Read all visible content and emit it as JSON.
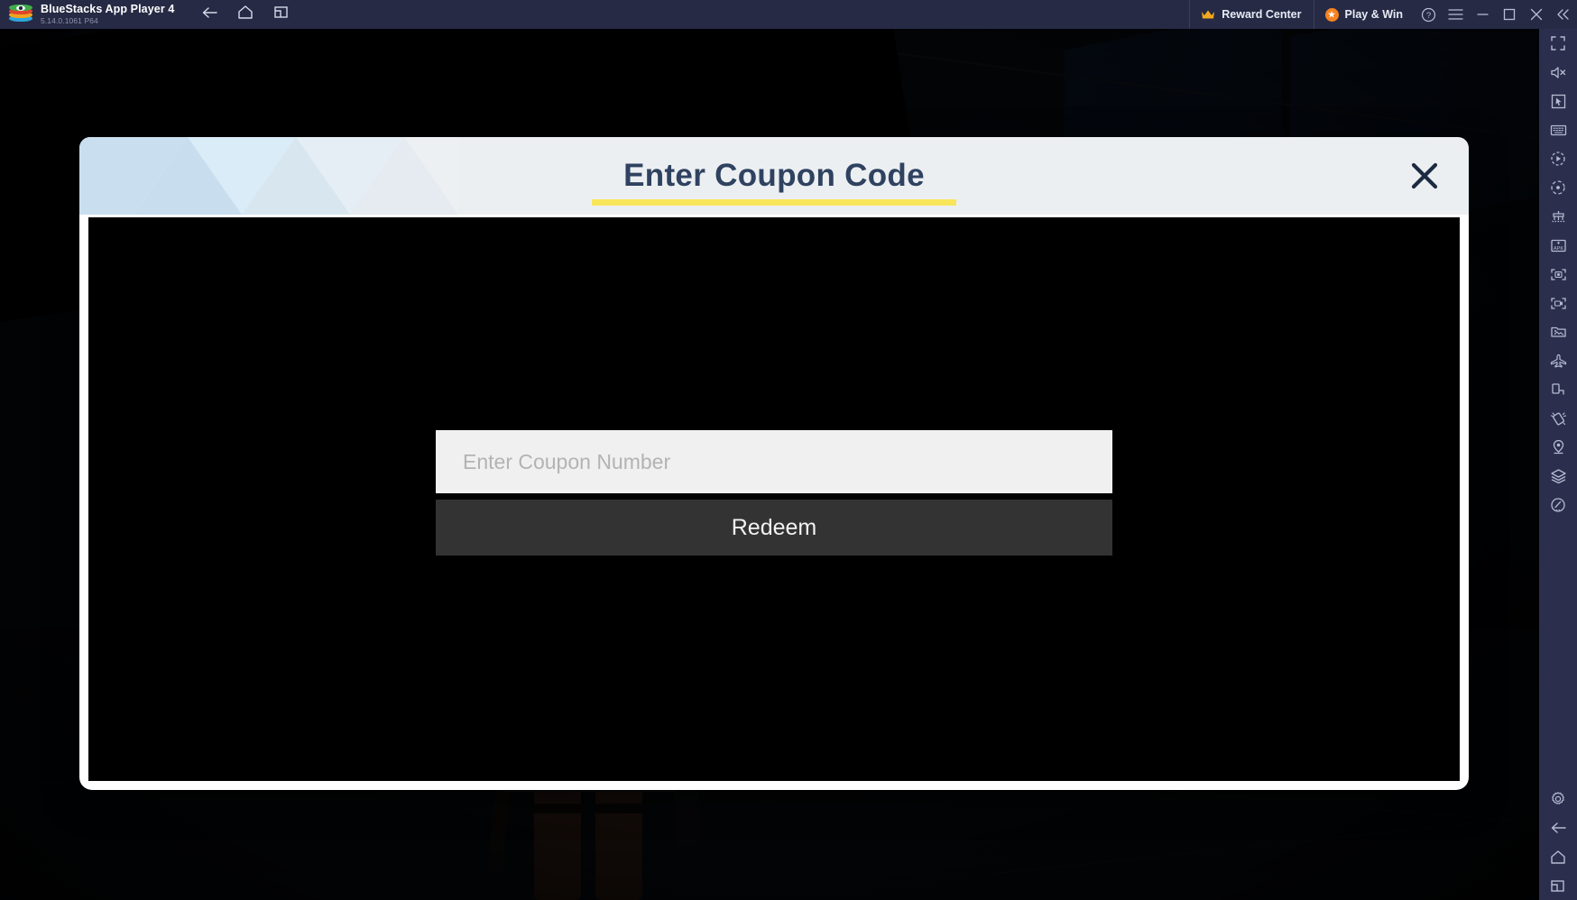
{
  "titlebar": {
    "app_name": "BlueStacks App Player 4",
    "version": "5.14.0.1061  P64",
    "logo_icon": "bluestacks-logo",
    "nav": [
      {
        "name": "back",
        "icon": "arrow-left-icon"
      },
      {
        "name": "home",
        "icon": "home-icon"
      },
      {
        "name": "multi-instance",
        "icon": "copy-window-icon"
      }
    ],
    "reward_center": {
      "label": "Reward Center",
      "icon": "crown-icon"
    },
    "play_and_win": {
      "label": "Play & Win",
      "icon": "orange-coin-icon"
    },
    "window_controls": [
      {
        "name": "help",
        "icon": "help-circle-icon"
      },
      {
        "name": "menu",
        "icon": "hamburger-icon"
      },
      {
        "name": "minimize",
        "icon": "minimize-icon"
      },
      {
        "name": "maximize",
        "icon": "maximize-icon"
      },
      {
        "name": "close",
        "icon": "close-icon"
      },
      {
        "name": "collapse-sidebar",
        "icon": "double-chevron-left-icon"
      }
    ]
  },
  "sidebar": {
    "items": [
      {
        "name": "fullscreen",
        "icon": "fullscreen-icon"
      },
      {
        "name": "mute",
        "icon": "speaker-mute-icon"
      },
      {
        "name": "game-controls",
        "icon": "cursor-in-box-icon"
      },
      {
        "name": "keyboard-controls",
        "icon": "keyboard-icon"
      },
      {
        "name": "macro-recorder",
        "icon": "play-record-icon"
      },
      {
        "name": "script",
        "icon": "script-dot-icon"
      },
      {
        "name": "multi-instance-manager",
        "icon": "instance-manager-icon"
      },
      {
        "name": "install-apk",
        "icon": "apk-install-icon"
      },
      {
        "name": "screenshot",
        "icon": "camera-icon"
      },
      {
        "name": "screen-record",
        "icon": "video-record-icon"
      },
      {
        "name": "media-manager",
        "icon": "media-folder-icon"
      },
      {
        "name": "eco-mode",
        "icon": "airplane-icon"
      },
      {
        "name": "rotate",
        "icon": "rotate-screen-icon"
      },
      {
        "name": "shake",
        "icon": "shake-device-icon"
      },
      {
        "name": "location",
        "icon": "location-pin-icon"
      },
      {
        "name": "layers",
        "icon": "layers-icon"
      },
      {
        "name": "performance",
        "icon": "speedometer-icon"
      }
    ],
    "bottom_items": [
      {
        "name": "settings",
        "icon": "gear-icon"
      },
      {
        "name": "back",
        "icon": "arrow-left-icon"
      },
      {
        "name": "home",
        "icon": "home-icon"
      },
      {
        "name": "recents",
        "icon": "recents-icon"
      }
    ]
  },
  "dialog": {
    "title": "Enter Coupon Code",
    "close_icon": "close-icon",
    "accent_underline_color": "#f9e55b",
    "title_color": "#2f4260",
    "header_bg": "#eceff2",
    "coupon_input": {
      "placeholder": "Enter Coupon Number",
      "value": ""
    },
    "redeem_button": {
      "label": "Redeem"
    }
  }
}
